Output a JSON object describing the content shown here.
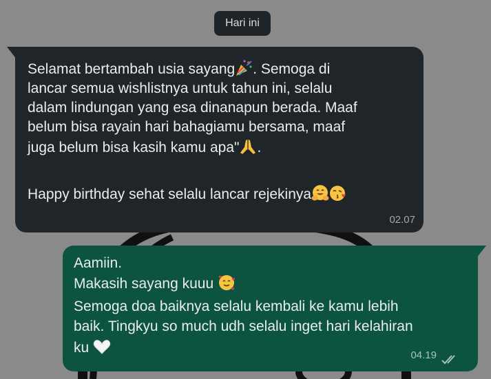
{
  "date_chip": "Hari ini",
  "incoming": {
    "lines": [
      "Selamat bertambah usia sayang",
      ". Semoga di",
      "lancar semua wishlistnya untuk tahun ini, selalu",
      "dalam lindungan yang esa dinanapun berada. Maaf",
      "belum bisa rayain hari bahagiamu bersama, maaf",
      "juga belum bisa kasih kamu apa\"",
      ".",
      "Happy birthday sehat selalu lancar rejekinya"
    ],
    "time": "02.07"
  },
  "outgoing": {
    "lines": [
      "Aamiin.",
      "Makasih sayang kuuu",
      "Semoga doa baiknya selalu kembali ke kamu lebih",
      "baik. Tingkyu so much udh selalu inget hari kelahiran",
      "ku"
    ],
    "time": "04.19",
    "status": "read"
  },
  "icons": {
    "party_popper": "party-popper-icon",
    "folded_hands": "folded-hands-icon",
    "hugging_face": "hugging-face-icon",
    "kissing_face": "face-blowing-kiss-icon",
    "hearts_face": "smiling-face-with-hearts-icon",
    "white_heart": "white-heart-icon",
    "read_ticks": "double-check-icon"
  },
  "colors": {
    "incoming_bubble": "#1f2529",
    "outgoing_bubble": "#0c5440",
    "background": "#8a8a8a",
    "chip": "#1e2428"
  }
}
